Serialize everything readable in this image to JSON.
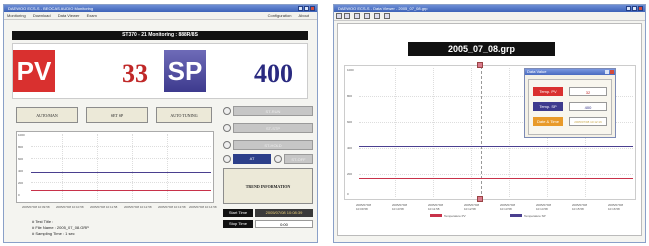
{
  "left_window": {
    "title": "DAEWOO ECS-S - BEOCAS AUDIO Monitoring",
    "menu": [
      "Monitoring",
      "Download",
      "Data Viewer",
      "Exam"
    ],
    "menu_right": [
      "Configuration",
      "About"
    ],
    "header": "ST370 - 21 Monitoring : 888R/8S",
    "pv_label": "PV",
    "pv_value": "33",
    "sp_label": "SP",
    "sp_value": "400",
    "buttons": [
      "AUTO/MAN",
      "SET SP",
      "AUTO TUNING"
    ],
    "status_items": [
      "ST-RUN",
      "ST-STP",
      "ST-HOLD"
    ],
    "at_label": "AT",
    "at_state": "ST-OFF",
    "trend_button": "TREND INFORMATION",
    "start_time_label": "Start Time",
    "start_time_value": "2005/07/08 10:08:39",
    "stop_time_label": "Stop Time",
    "stop_time_value": "0:00",
    "y_ticks": [
      "1000",
      "800",
      "600",
      "400",
      "200",
      "0"
    ],
    "x_ticks": [
      "2005/07/08 10:09:58",
      "2005/07/08 10:10:58",
      "2005/07/08 10:11:58",
      "2005/07/08 10:12:58",
      "2005/07/08 10:13:58",
      "2005/07/08 10:14:58"
    ],
    "test_title": "# Test Title :",
    "file_name": "# File Name : 2005_07_08.GRP",
    "sampling_time": "# Sampling Time : 1 sec"
  },
  "right_window": {
    "title": "DAEWOO ECS-S - Data Viewer - 2005_07_08.grp",
    "file_title": "2005_07_08.grp",
    "y_ticks": [
      "1000",
      "800",
      "600",
      "400",
      "200",
      "0"
    ],
    "x_ticks": [
      "2005/07/08 10:09:58",
      "2005/07/08 10:10:58",
      "2005/07/08 10:11:58",
      "2005/07/08 10:12:58",
      "2005/07/08 10:13:58",
      "2005/07/08 10:14:58",
      "2005/07/08 10:15:58",
      "2005/07/08 10:16:58"
    ],
    "popup_title": "Data Value",
    "popup_rows": [
      {
        "label": "Temp. PV",
        "value": "32",
        "color": "#d9302f"
      },
      {
        "label": "Temp. SP",
        "value": "400",
        "color": "#3d3a8e"
      },
      {
        "label": "Date & Time",
        "value": "2005/07/08 10:12:16",
        "color": "#e89a2a"
      }
    ],
    "legend": [
      {
        "name": "Temperature PV",
        "color": "#c8324a"
      },
      {
        "name": "Temperature SP",
        "color": "#4a3f8f"
      }
    ]
  }
}
